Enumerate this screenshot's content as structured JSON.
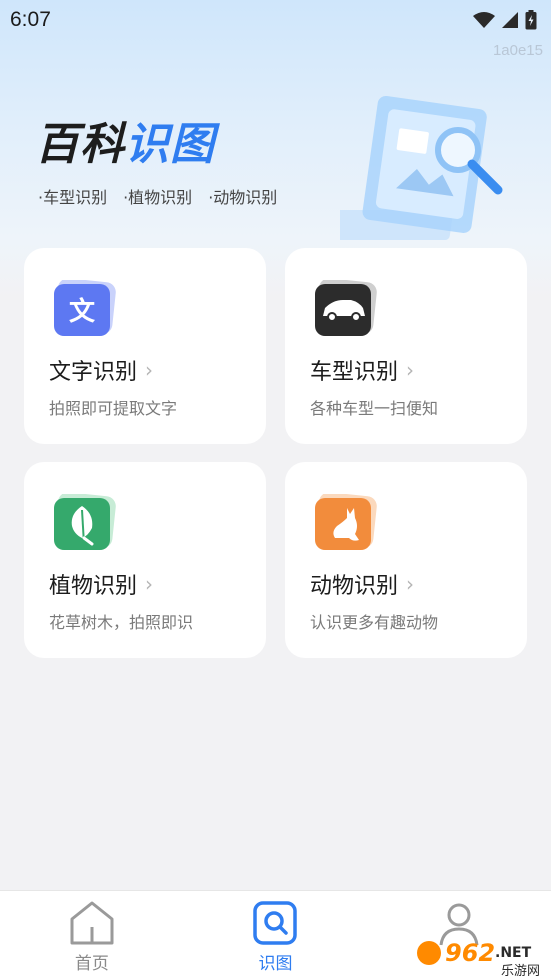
{
  "status_bar": {
    "time": "6:07"
  },
  "build_id": "1a0e15",
  "brand": {
    "part1": "百科",
    "part2": "识图"
  },
  "tags": [
    "·车型识别",
    "·植物识别",
    "·动物识别"
  ],
  "cards": [
    {
      "title": "文字识别",
      "desc": "拍照即可提取文字",
      "icon": "text-recognition-icon",
      "glyph": "文",
      "color": "#5b76f0"
    },
    {
      "title": "车型识别",
      "desc": "各种车型一扫便知",
      "icon": "car-icon",
      "color": "#2b2b2b"
    },
    {
      "title": "植物识别",
      "desc": "花草树木，拍照即识",
      "icon": "leaf-icon",
      "color": "#33a86a"
    },
    {
      "title": "动物识别",
      "desc": "认识更多有趣动物",
      "icon": "cat-icon",
      "color": "#f08a3a"
    }
  ],
  "tabbar": {
    "items": [
      {
        "label": "首页",
        "icon": "home-icon",
        "active": false
      },
      {
        "label": "识图",
        "icon": "scan-icon",
        "active": true
      },
      {
        "label": "",
        "icon": "profile-icon",
        "active": false
      }
    ],
    "active_color": "#2f7df0",
    "inactive_color": "#8a8a8a"
  },
  "watermark": {
    "number": "962",
    "suffix": ".NET",
    "subtitle": "乐游网"
  }
}
